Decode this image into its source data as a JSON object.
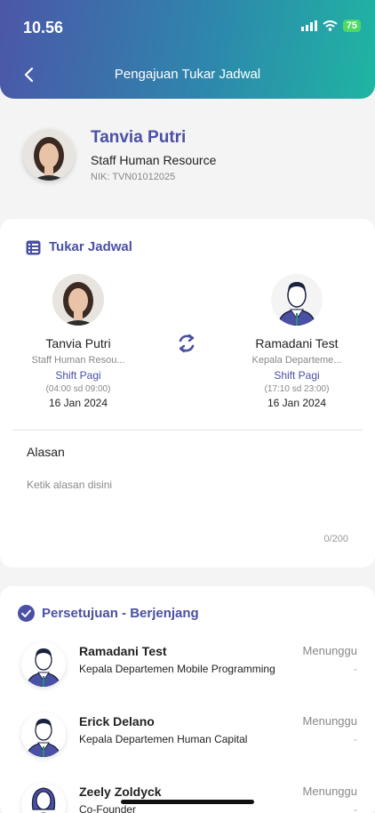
{
  "status_bar": {
    "time": "10.56",
    "battery": "75"
  },
  "header": {
    "title": "Pengajuan Tukar Jadwal"
  },
  "profile": {
    "name": "Tanvia Putri",
    "role": "Staff Human Resource",
    "nik": "NIK: TVN01012025"
  },
  "swap": {
    "section_title": "Tukar Jadwal",
    "from": {
      "name": "Tanvia Putri",
      "role": "Staff Human Resou...",
      "shift": "Shift Pagi",
      "time": "(04:00 sd 09:00)",
      "date": "16 Jan 2024"
    },
    "to": {
      "name": "Ramadani Test",
      "role": "Kepala Departeme...",
      "shift": "Shift Pagi",
      "time": "(17:10 sd 23:00)",
      "date": "16 Jan 2024"
    }
  },
  "reason": {
    "label": "Alasan",
    "placeholder": "Ketik alasan disini",
    "counter": "0/200"
  },
  "approval": {
    "section_title": "Persetujuan - Berjenjang",
    "items": [
      {
        "name": "Ramadani Test",
        "role": "Kepala Departemen Mobile Programming",
        "status": "Menunggu",
        "date": "-"
      },
      {
        "name": "Erick Delano",
        "role": "Kepala Departemen Human Capital",
        "status": "Menunggu",
        "date": "-"
      },
      {
        "name": "Zeely Zoldyck",
        "role": "Co-Founder",
        "status": "Menunggu",
        "date": "-"
      }
    ]
  },
  "colors": {
    "accent": "#4a50a3",
    "header_start": "#4c56a8",
    "header_end": "#1fb5a2"
  }
}
